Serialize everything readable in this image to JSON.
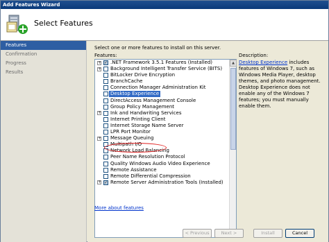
{
  "window": {
    "title": "Add Features Wizard"
  },
  "header": {
    "title": "Select Features"
  },
  "steps": [
    {
      "label": "Features",
      "active": true
    },
    {
      "label": "Confirmation",
      "active": false
    },
    {
      "label": "Progress",
      "active": false
    },
    {
      "label": "Results",
      "active": false
    }
  ],
  "main": {
    "instructions": "Select one or more features to install on this server.",
    "features_label": "Features:",
    "description_label": "Description:",
    "description_link": "Desktop Experience",
    "description_text": " includes features of Windows 7, such as Windows Media Player, desktop themes, and photo management. Desktop Experience does not enable any of the Windows 7 features; you must manually enable them.",
    "more_link": "More about features"
  },
  "features": [
    {
      "label": ".NET Framework 3.5.1 Features  (Installed)",
      "expandable": true,
      "checked": true
    },
    {
      "label": "Background Intelligent Transfer Service (BITS)",
      "expandable": true,
      "checked": false
    },
    {
      "label": "BitLocker Drive Encryption",
      "expandable": false,
      "checked": false
    },
    {
      "label": "BranchCache",
      "expandable": false,
      "checked": false
    },
    {
      "label": "Connection Manager Administration Kit",
      "expandable": false,
      "checked": false
    },
    {
      "label": "Desktop Experience",
      "expandable": false,
      "checked": false,
      "selected": true
    },
    {
      "label": "DirectAccess Management Console",
      "expandable": false,
      "checked": false
    },
    {
      "label": "Group Policy Management",
      "expandable": false,
      "checked": false
    },
    {
      "label": "Ink and Handwriting Services",
      "expandable": true,
      "checked": false
    },
    {
      "label": "Internet Printing Client",
      "expandable": false,
      "checked": false
    },
    {
      "label": "Internet Storage Name Server",
      "expandable": false,
      "checked": false
    },
    {
      "label": "LPR Port Monitor",
      "expandable": false,
      "checked": false
    },
    {
      "label": "Message Queuing",
      "expandable": true,
      "checked": false
    },
    {
      "label": "Multipath I/O",
      "expandable": false,
      "checked": false
    },
    {
      "label": "Network Load Balancing",
      "expandable": false,
      "checked": false
    },
    {
      "label": "Peer Name Resolution Protocol",
      "expandable": false,
      "checked": false
    },
    {
      "label": "Quality Windows Audio Video Experience",
      "expandable": false,
      "checked": false
    },
    {
      "label": "Remote Assistance",
      "expandable": false,
      "checked": false
    },
    {
      "label": "Remote Differential Compression",
      "expandable": false,
      "checked": false
    },
    {
      "label": "Remote Server Administration Tools  (Installed)",
      "expandable": true,
      "checked": true
    }
  ],
  "buttons": {
    "previous": "< Previous",
    "next": "Next >",
    "install": "Install",
    "cancel": "Cancel"
  },
  "colors": {
    "active_step": "#2e5ea3",
    "highlight": "#e02020",
    "selection": "#316ac5"
  }
}
